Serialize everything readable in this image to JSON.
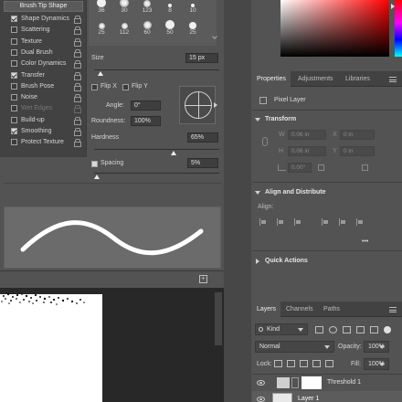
{
  "brush_settings": {
    "tip_shape_button": "Brush Tip Shape",
    "options": [
      {
        "label": "Shape Dynamics",
        "checked": true,
        "disabled": false
      },
      {
        "label": "Scattering",
        "checked": false,
        "disabled": false
      },
      {
        "label": "Texture",
        "checked": false,
        "disabled": false
      },
      {
        "label": "Dual Brush",
        "checked": false,
        "disabled": false
      },
      {
        "label": "Color Dynamics",
        "checked": false,
        "disabled": false
      },
      {
        "label": "Transfer",
        "checked": true,
        "disabled": false
      },
      {
        "label": "Brush Pose",
        "checked": false,
        "disabled": false
      },
      {
        "label": "Noise",
        "checked": false,
        "disabled": false
      },
      {
        "label": "Wet Edges",
        "checked": false,
        "disabled": true
      },
      {
        "label": "Build-up",
        "checked": false,
        "disabled": false
      },
      {
        "label": "Smoothing",
        "checked": true,
        "disabled": false
      },
      {
        "label": "Protect Texture",
        "checked": false,
        "disabled": false
      }
    ],
    "tips": [
      {
        "size": "36"
      },
      {
        "size": "30"
      },
      {
        "size": "123"
      },
      {
        "size": "8"
      },
      {
        "size": "10"
      },
      {
        "size": "25"
      },
      {
        "size": "112"
      },
      {
        "size": "60"
      },
      {
        "size": "50"
      },
      {
        "size": "25"
      }
    ],
    "size_label": "Size",
    "size_value": "15 px",
    "size_slider_level": 0.05,
    "flip_x_label": "Flip X",
    "flip_y_label": "Flip Y",
    "angle_label": "Angle:",
    "angle_value": "0°",
    "roundness_label": "Roundness:",
    "roundness_value": "100%",
    "hardness_label": "Hardness",
    "hardness_value": "65%",
    "hardness_level": 0.65,
    "spacing_label": "Spacing",
    "spacing_value": "5%",
    "spacing_checked": true,
    "spacing_level": 0.02
  },
  "color_picker": {
    "hue": "#ff0000"
  },
  "properties_panel": {
    "tabs": [
      {
        "label": "Properties",
        "active": true
      },
      {
        "label": "Adjustments",
        "active": false
      },
      {
        "label": "Libraries",
        "active": false
      }
    ],
    "layer_kind": "Pixel Layer",
    "transform_title": "Transform",
    "w_label": "W",
    "w_value": "0.06 in",
    "h_label": "H",
    "h_value": "0.06 in",
    "x_label": "X",
    "x_value": "0 in",
    "y_label": "Y",
    "y_value": "0 in",
    "angle_value": "0.00°",
    "align_title": "Align and Distribute",
    "align_label": "Align:",
    "more_label": "•••",
    "quick_actions_title": "Quick Actions"
  },
  "layers_panel": {
    "tabs": [
      {
        "label": "Layers",
        "active": true
      },
      {
        "label": "Channels",
        "active": false
      },
      {
        "label": "Paths",
        "active": false
      }
    ],
    "kind_filter": "Kind",
    "blend_mode": "Normal",
    "opacity_label": "Opacity:",
    "opacity_value": "100%",
    "lock_label": "Lock:",
    "fill_label": "Fill:",
    "fill_value": "100%",
    "layers": [
      {
        "name": "Threshold 1",
        "visible": true
      },
      {
        "name": "Layer 1",
        "visible": true
      }
    ]
  }
}
